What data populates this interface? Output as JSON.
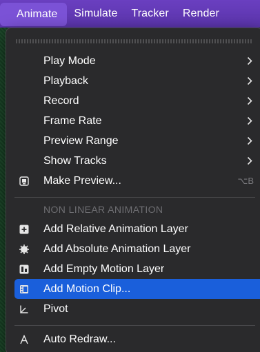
{
  "menubar": {
    "items": [
      {
        "label": "Animate",
        "active": true
      },
      {
        "label": "Simulate"
      },
      {
        "label": "Tracker"
      },
      {
        "label": "Render"
      }
    ]
  },
  "menu": {
    "submenus": [
      {
        "label": "Play Mode",
        "icon": "chevron-right-icon"
      },
      {
        "label": "Playback",
        "icon": "chevron-right-icon"
      },
      {
        "label": "Record",
        "icon": "chevron-right-icon"
      },
      {
        "label": "Frame Rate",
        "icon": "chevron-right-icon"
      },
      {
        "label": "Preview Range",
        "icon": "chevron-right-icon"
      },
      {
        "label": "Show Tracks",
        "icon": "chevron-right-icon"
      }
    ],
    "make_preview": {
      "label": "Make Preview...",
      "shortcut": "⌥B",
      "icon": "preview-icon"
    },
    "section_header": "NON LINEAR ANIMATION",
    "nla_items": [
      {
        "label": "Add Relative Animation Layer",
        "icon": "relative-layer-icon"
      },
      {
        "label": "Add Absolute Animation Layer",
        "icon": "absolute-layer-icon"
      },
      {
        "label": "Add Empty Motion Layer",
        "icon": "empty-motion-layer-icon"
      },
      {
        "label": "Add Motion Clip...",
        "icon": "motion-clip-icon",
        "selected": true
      },
      {
        "label": "Pivot",
        "icon": "pivot-icon"
      }
    ],
    "auto_redraw": {
      "label": "Auto Redraw...",
      "icon": "auto-redraw-icon"
    }
  },
  "colors": {
    "menubar": "#6a3fc0",
    "menubar_active": "#7b52d6",
    "menu_bg": "#2a2a2c",
    "selection": "#1a5fdb",
    "text": "#ffffff",
    "muted": "#6e6e72"
  }
}
